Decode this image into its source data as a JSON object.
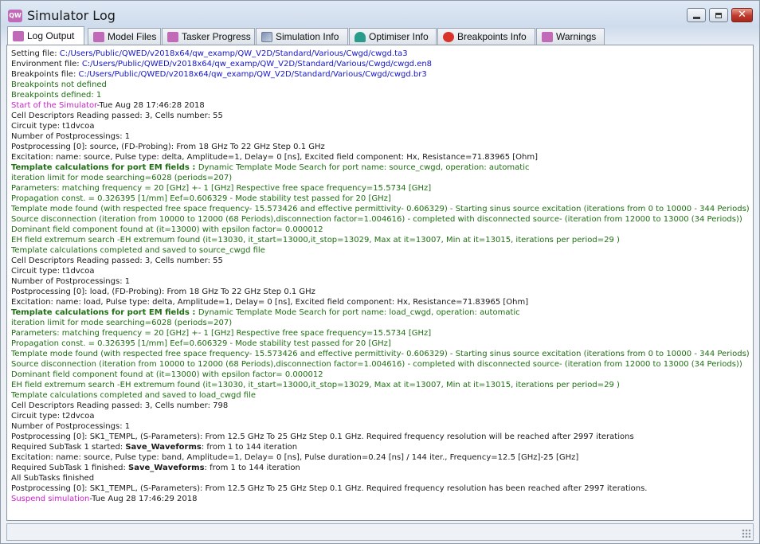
{
  "window": {
    "title": "Simulator Log",
    "app_icon": "QW"
  },
  "window_buttons": {
    "minimize": "minimize-icon",
    "maximize": "maximize-icon",
    "close": "close-icon"
  },
  "tabs": [
    {
      "label": "Log Output",
      "icon": "qw-icon",
      "active": true
    },
    {
      "label": "Model Files",
      "icon": "qw-icon"
    },
    {
      "label": "Tasker Progress",
      "icon": "qw-icon"
    },
    {
      "label": "Simulation Info",
      "icon": "simulation-icon"
    },
    {
      "label": "Optimiser Info",
      "icon": "optimiser-icon"
    },
    {
      "label": "Breakpoints Info",
      "icon": "breakpoint-icon"
    },
    {
      "label": "Warnings",
      "icon": "qw-icon"
    }
  ],
  "colors": {
    "black": "#1a1a1a",
    "blue": "#1515c8",
    "green": "#1e6e12",
    "magenta": "#cc1fcc"
  },
  "log": [
    [
      {
        "t": "Setting file: ",
        "c": "black"
      },
      {
        "t": "C:/Users/Public/QWED/v2018x64/qw_examp/QW_V2D/Standard/Various/Cwgd/cwgd.ta3",
        "c": "blue"
      }
    ],
    [
      {
        "t": "Environment file: ",
        "c": "black"
      },
      {
        "t": "C:/Users/Public/QWED/v2018x64/qw_examp/QW_V2D/Standard/Various/Cwgd/cwgd.en8",
        "c": "blue"
      }
    ],
    [
      {
        "t": "Breakpoints file: ",
        "c": "black"
      },
      {
        "t": "C:/Users/Public/QWED/v2018x64/qw_examp/QW_V2D/Standard/Various/Cwgd/cwgd.br3",
        "c": "blue"
      }
    ],
    [
      {
        "t": "Breakpoints not defined",
        "c": "green"
      }
    ],
    [
      {
        "t": "Breakpoints defined: 1",
        "c": "green"
      }
    ],
    [
      {
        "t": "Start of the Simulator",
        "c": "magenta"
      },
      {
        "t": "-Tue Aug 28 17:46:28 2018",
        "c": "black"
      }
    ],
    [
      {
        "t": "Cell Descriptors Reading passed: 3, Cells number: 55",
        "c": "black"
      }
    ],
    [
      {
        "t": "Circuit type: t1dvcoa",
        "c": "black"
      }
    ],
    [
      {
        "t": "Number of Postprocessings: 1",
        "c": "black"
      }
    ],
    [
      {
        "t": "Postprocessing [0]: source, (FD-Probing): From 18 GHz To 22 GHz Step 0.1 GHz",
        "c": "black"
      }
    ],
    [
      {
        "t": "Excitation: name: source, Pulse type: delta, Amplitude=1, Delay= 0 [ns], Excited field component: Hx, Resistance=71.83965 [Ohm]",
        "c": "black"
      }
    ],
    [
      {
        "t": "Template calculations for port EM fields : ",
        "c": "green",
        "b": true
      },
      {
        "t": "Dynamic Template Mode Search for port name: source_cwgd, operation: automatic",
        "c": "green"
      }
    ],
    [
      {
        "t": "iteration limit for mode searching=6028 (periods=207)",
        "c": "green"
      }
    ],
    [
      {
        "t": "Parameters: matching frequency = 20 [GHz] +- 1 [GHz] Respective free space frequency=15.5734 [GHz]",
        "c": "green"
      }
    ],
    [
      {
        "t": "Propagation const. = 0.326395 [1/mm] Eef=0.606329 - Mode stability test passed for 20 [GHz]",
        "c": "green"
      }
    ],
    [
      {
        "t": "Template mode found (with respected free space frequency- 15.573426 and effective permittivity- 0.606329) - Starting sinus source excitation (iterations from 0 to 10000 - 344 Periods)",
        "c": "green"
      }
    ],
    [
      {
        "t": "Source disconnection (iteration from 10000 to 12000 (68 Periods),disconnection factor=1.004616) - completed with disconnected source- (iteration from 12000 to 13000 (34 Periods))",
        "c": "green"
      }
    ],
    [
      {
        "t": "Dominant field component found at (it=13000) with epsilon factor= 0.000012",
        "c": "green"
      }
    ],
    [
      {
        "t": "EH field extremum search -EH extremum found (it=13030, it_start=13000,it_stop=13029, Max at it=13007, Min at it=13015, iterations per period=29 )",
        "c": "green"
      }
    ],
    [
      {
        "t": "Template calculations completed and saved to source_cwgd file",
        "c": "green"
      }
    ],
    [
      {
        "t": "Cell Descriptors Reading passed: 3, Cells number: 55",
        "c": "black"
      }
    ],
    [
      {
        "t": "Circuit type: t1dvcoa",
        "c": "black"
      }
    ],
    [
      {
        "t": "Number of Postprocessings: 1",
        "c": "black"
      }
    ],
    [
      {
        "t": "Postprocessing [0]: load, (FD-Probing): From 18 GHz To 22 GHz Step 0.1 GHz",
        "c": "black"
      }
    ],
    [
      {
        "t": "Excitation: name: load, Pulse type: delta, Amplitude=1, Delay= 0 [ns], Excited field component: Hx, Resistance=71.83965 [Ohm]",
        "c": "black"
      }
    ],
    [
      {
        "t": "Template calculations for port EM fields : ",
        "c": "green",
        "b": true
      },
      {
        "t": "Dynamic Template Mode Search for port name: load_cwgd, operation: automatic",
        "c": "green"
      }
    ],
    [
      {
        "t": "iteration limit for mode searching=6028 (periods=207)",
        "c": "green"
      }
    ],
    [
      {
        "t": "Parameters: matching frequency = 20 [GHz] +- 1 [GHz] Respective free space frequency=15.5734 [GHz]",
        "c": "green"
      }
    ],
    [
      {
        "t": "Propagation const. = 0.326395 [1/mm] Eef=0.606329 - Mode stability test passed for 20 [GHz]",
        "c": "green"
      }
    ],
    [
      {
        "t": "Template mode found (with respected free space frequency- 15.573426 and effective permittivity- 0.606329) - Starting sinus source excitation (iterations from 0 to 10000 - 344 Periods)",
        "c": "green"
      }
    ],
    [
      {
        "t": "Source disconnection (iteration from 10000 to 12000 (68 Periods),disconnection factor=1.004616) - completed with disconnected source- (iteration from 12000 to 13000 (34 Periods))",
        "c": "green"
      }
    ],
    [
      {
        "t": "Dominant field component found at (it=13000) with epsilon factor= 0.000012",
        "c": "green"
      }
    ],
    [
      {
        "t": "EH field extremum search -EH extremum found (it=13030, it_start=13000,it_stop=13029, Max at it=13007, Min at it=13015, iterations per period=29 )",
        "c": "green"
      }
    ],
    [
      {
        "t": "Template calculations completed and saved to load_cwgd file",
        "c": "green"
      }
    ],
    [
      {
        "t": "Cell Descriptors Reading passed: 3, Cells number: 798",
        "c": "black"
      }
    ],
    [
      {
        "t": "Circuit type: t2dvcoa",
        "c": "black"
      }
    ],
    [
      {
        "t": "Number of Postprocessings: 1",
        "c": "black"
      }
    ],
    [
      {
        "t": "Postprocessing [0]: SK1_TEMPL, (S-Parameters): From 12.5 GHz To 25 GHz Step 0.1 GHz. Required frequency resolution will be reached after 2997 iterations",
        "c": "black"
      }
    ],
    [
      {
        "t": "Required SubTask 1 started: ",
        "c": "black"
      },
      {
        "t": "Save_Waveforms",
        "c": "black",
        "b": true
      },
      {
        "t": ": from 1 to 144 iteration",
        "c": "black"
      }
    ],
    [
      {
        "t": "Excitation: name: source, Pulse type: band, Amplitude=1, Delay= 0 [ns], Pulse duration=0.24 [ns] / 144 iter., Frequency=12.5 [GHz]-25 [GHz]",
        "c": "black"
      }
    ],
    [
      {
        "t": "Required SubTask 1 finished: ",
        "c": "black"
      },
      {
        "t": "Save_Waveforms",
        "c": "black",
        "b": true
      },
      {
        "t": ": from 1 to 144 iteration",
        "c": "black"
      }
    ],
    [
      {
        "t": "All SubTasks finished",
        "c": "black"
      }
    ],
    [
      {
        "t": "Postprocessing [0]: SK1_TEMPL, (S-Parameters): From 12.5 GHz To 25 GHz Step 0.1 GHz. Required frequency resolution has been reached after 2997 iterations.",
        "c": "black"
      }
    ],
    [
      {
        "t": "Suspend simulation",
        "c": "magenta"
      },
      {
        "t": "-Tue Aug 28 17:46:29 2018",
        "c": "black"
      }
    ]
  ]
}
